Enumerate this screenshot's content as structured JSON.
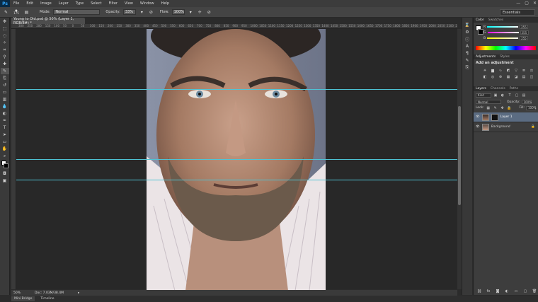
{
  "app": {
    "logo": "Ps",
    "menus": [
      "File",
      "Edit",
      "Image",
      "Layer",
      "Type",
      "Select",
      "Filter",
      "View",
      "Window",
      "Help"
    ],
    "window_controls": [
      "—",
      "▢",
      "✕"
    ]
  },
  "options": {
    "brush_size": "175",
    "mode_label": "Mode:",
    "mode_value": "Normal",
    "opacity_label": "Opacity:",
    "opacity_value": "33%",
    "flow_label": "Flow:",
    "flow_value": "100%",
    "workspace": "Essentials"
  },
  "document": {
    "tab_title": "Young to Old.psd @ 50% (Layer 1, RGB/8#) *",
    "zoom": "50%",
    "doc_size": "Doc: 7.03M/38.4M",
    "ruler_ticks": [
      "300",
      "250",
      "200",
      "150",
      "100",
      "50",
      "0",
      "50",
      "100",
      "150",
      "200",
      "250",
      "300",
      "350",
      "400",
      "450",
      "500",
      "550",
      "600",
      "650",
      "700",
      "750",
      "800",
      "850",
      "900",
      "950",
      "1000",
      "1050",
      "1100",
      "1150",
      "1200",
      "1250",
      "1300",
      "1350",
      "1400",
      "1450",
      "1500",
      "1550",
      "1600",
      "1650",
      "1700",
      "1750",
      "1800",
      "1850",
      "1900",
      "1950",
      "2000",
      "2050",
      "2100",
      "2150"
    ]
  },
  "bottom_tabs": [
    "Mini Bridge",
    "Timeline"
  ],
  "color_panel": {
    "tabs": [
      "Color",
      "Swatches"
    ],
    "channels": [
      {
        "label": "R",
        "value": "255",
        "color": "#ff4d4d"
      },
      {
        "label": "G",
        "value": "255",
        "color": "#4dff4d"
      },
      {
        "label": "B",
        "value": "255",
        "color": "#4d7dff"
      }
    ]
  },
  "adjustments_panel": {
    "tabs": [
      "Adjustments",
      "Styles"
    ],
    "heading": "Add an adjustment",
    "icons": [
      "brightness-icon",
      "levels-icon",
      "curves-icon",
      "exposure-icon",
      "vibrance-icon",
      "hue-icon",
      "balance-icon",
      "bw-icon",
      "photo-filter-icon",
      "channel-mixer-icon",
      "lookup-icon",
      "invert-icon",
      "posterize-icon",
      "threshold-icon",
      "gradient-map-icon",
      "selective-color-icon",
      "gradient-icon",
      "pattern-icon"
    ]
  },
  "layers_panel": {
    "tabs": [
      "Layers",
      "Channels",
      "Paths"
    ],
    "filter_kind": "Kind",
    "blend_mode": "Normal",
    "opacity_label": "Opacity:",
    "opacity_value": "100%",
    "lock_label": "Lock:",
    "fill_label": "Fill:",
    "fill_value": "100%",
    "layers": [
      {
        "name": "Layer 1",
        "selected": true,
        "italic": false
      },
      {
        "name": "Background",
        "selected": false,
        "italic": true
      }
    ]
  },
  "colors": {
    "accent_selection": "#5b6c82",
    "guide": "#4fc3d4"
  }
}
